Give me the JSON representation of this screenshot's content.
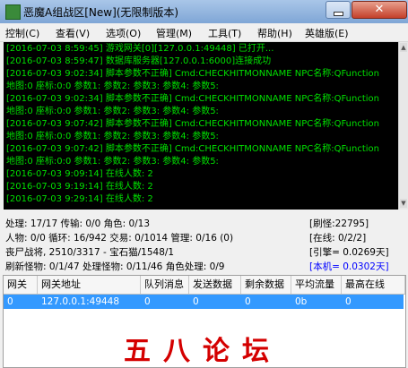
{
  "window": {
    "title": "恶魔A组战区[New](无限制版本)",
    "close_label": "✕"
  },
  "menu": [
    "控制(C)",
    "查看(V)",
    "选项(O)",
    "管理(M)",
    "工具(T)",
    "帮助(H)",
    "英雄版(E)"
  ],
  "log": [
    "[2016-07-03 8:59:45] 游戏网关[0][127.0.0.1:49448] 已打开...",
    "[2016-07-03 8:59:47] 数据库服务器[127.0.0.1:6000]连接成功",
    "[2016-07-03 9:02:34] 脚本参数不正确] Cmd:CHECKHITMONNAME NPC名称:QFunction",
    "地图:0 座标:0:0 参数1: 参数2: 参数3: 参数4: 参数5:",
    "[2016-07-03 9:02:34] 脚本参数不正确] Cmd:CHECKHITMONNAME NPC名称:QFunction",
    "地图:0 座标:0:0 参数1: 参数2: 参数3: 参数4: 参数5:",
    "[2016-07-03 9:07:42] 脚本参数不正确] Cmd:CHECKHITMONNAME NPC名称:QFunction",
    "地图:0 座标:0:0 参数1: 参数2: 参数3: 参数4: 参数5:",
    "[2016-07-03 9:07:42] 脚本参数不正确] Cmd:CHECKHITMONNAME NPC名称:QFunction",
    "地图:0 座标:0:0 参数1: 参数2: 参数3: 参数4: 参数5:",
    "[2016-07-03 9:09:14] 在线人数: 2",
    "[2016-07-03 9:19:14] 在线人数: 2",
    "[2016-07-03 9:29:14] 在线人数: 2"
  ],
  "status": {
    "row1_left": "处理: 17/17  传输: 0/0  角色: 0/13",
    "row1_right": "[刷怪:22795]",
    "row2_left": "人物: 0/0  循环: 16/942  交易: 0/1014  管理: 0/16  (0)",
    "row2_right": "[在线: 0/2/2]",
    "row3_left": "丧尸战将, 2510/3317 - 宝石猫/1548/1",
    "row3_right": "[引擎= 0.0269天]",
    "row4_left": "刷新怪物: 0/1/47  处理怪物: 0/11/46  角色处理: 0/9",
    "row4_right": "[本机= 0.0302天]"
  },
  "grid": {
    "headers": [
      "网关",
      "网关地址",
      "队列消息",
      "发送数据",
      "剩余数据",
      "平均流量",
      "最高在线"
    ],
    "rows": [
      [
        "0",
        "127.0.0.1:49448",
        "0",
        "0",
        "0",
        "0b",
        "0"
      ]
    ]
  },
  "watermark": "五八论坛"
}
